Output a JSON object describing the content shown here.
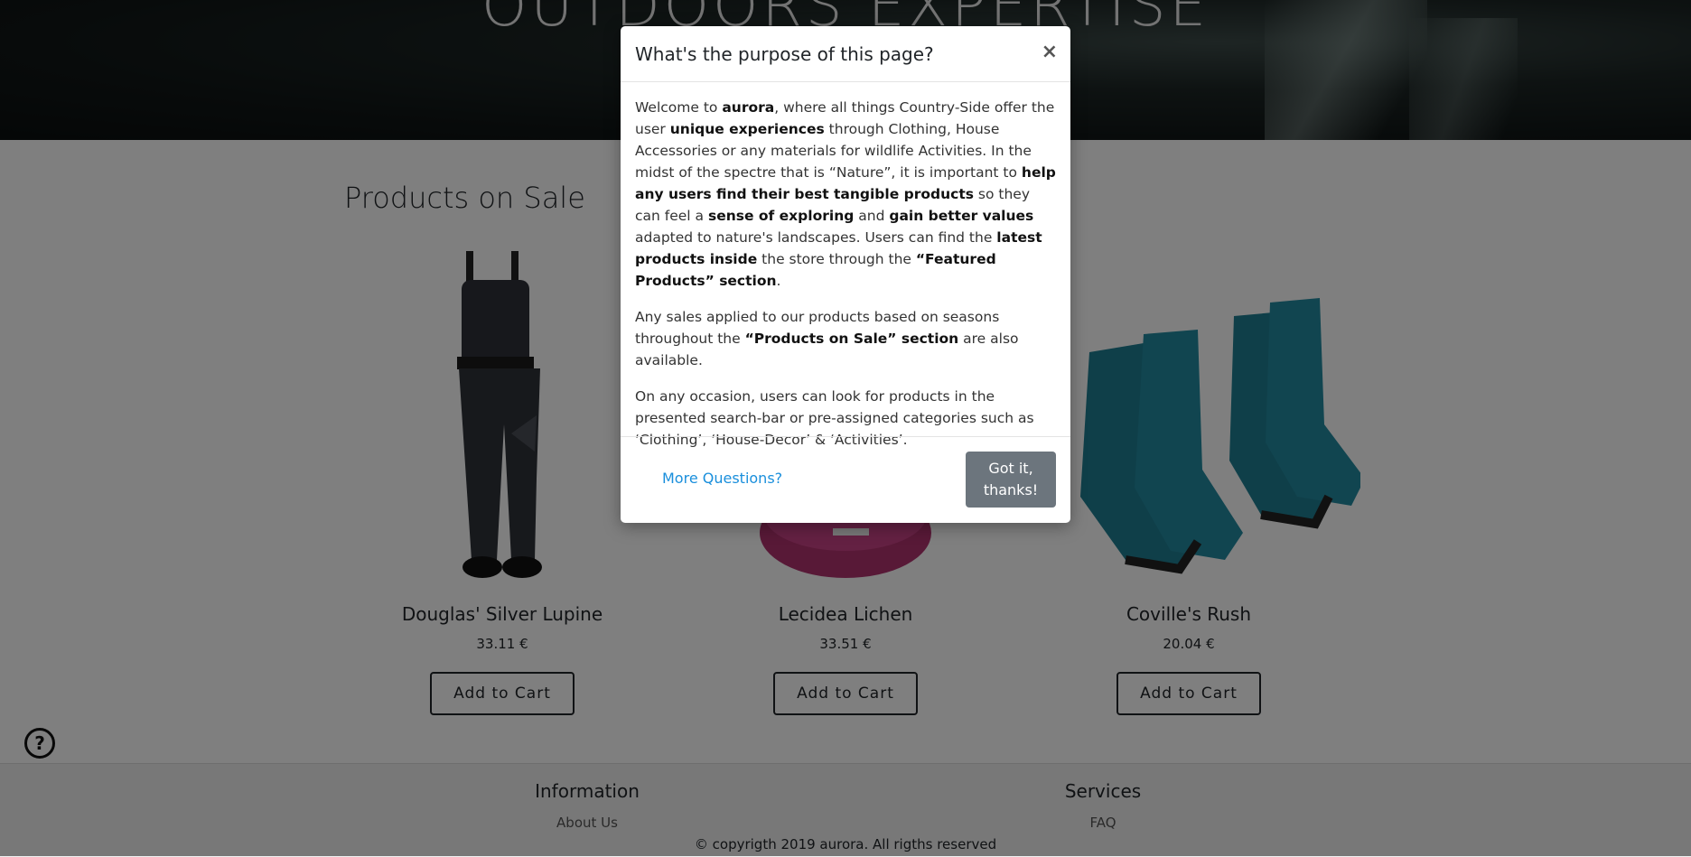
{
  "hero": {
    "title": "OUTDOORS EXPERTISE"
  },
  "section": {
    "title": "Products on Sale"
  },
  "products": [
    {
      "name": "Douglas' Silver Lupine",
      "price": "33.11 €",
      "button": "Add to Cart"
    },
    {
      "name": "Lecidea Lichen",
      "price": "33.51 €",
      "button": "Add to Cart"
    },
    {
      "name": "Coville's Rush",
      "price": "20.04 €",
      "button": "Add to Cart"
    }
  ],
  "footer": {
    "information": {
      "heading": "Information",
      "link": "About Us"
    },
    "services": {
      "heading": "Services",
      "link": "FAQ"
    },
    "copyright": "copyrigth 2019 aurora. All rigths reserved"
  },
  "modal": {
    "title": "What's the purpose of this page?",
    "close": "×",
    "p1": {
      "t1": "Welcome to ",
      "b1": "aurora",
      "t2": ", where all things Country-Side offer the user ",
      "b2": "unique experiences",
      "t3": " through Clothing, House Accessories or any materials for wildlife Activities. In the midst of the spectre that is “Nature”, it is important to ",
      "b3": "help any users find their best tangible products",
      "t4": " so they can feel a ",
      "b4": "sense of exploring",
      "t5": " and ",
      "b5": "gain better values",
      "t6": " adapted to nature's landscapes. Users can find the ",
      "b6": "latest products inside",
      "t7": " the store through the ",
      "b7": "“Featured Products” section",
      "t8": "."
    },
    "p2": {
      "t1": "Any sales applied to our products based on seasons throughout the ",
      "b1": "“Products on Sale” section",
      "t2": " are also available."
    },
    "p3": "On any occasion, users can look for products in the presented search-bar or pre-assigned categories such as ‘Clothing’, ‘House-Decor’ & ‘Activities’.",
    "more_link": "More Questions?",
    "button": "Got it, thanks!"
  },
  "help": {
    "icon": "question-circle-icon",
    "glyph": "?"
  }
}
